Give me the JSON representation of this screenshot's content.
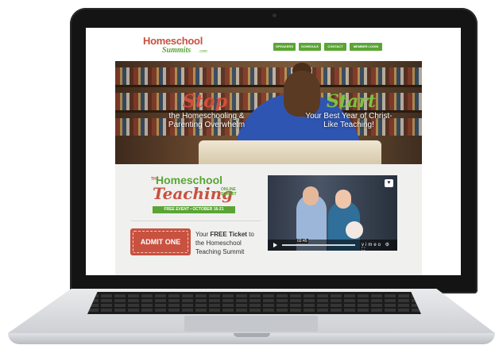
{
  "site": {
    "logo_main": "Homeschool",
    "logo_sub": "Summits",
    "logo_domain": ".com",
    "nav": [
      "SPEAKERS",
      "SCHEDULE",
      "CONTACT",
      "MEMBER LOGIN"
    ]
  },
  "hero": {
    "left_word": "Stop",
    "left_text": "the Homeschooling & Parenting Overwhelm",
    "right_word": "Start",
    "right_text": "Your Best Year of Christ-Like Teaching!"
  },
  "summit": {
    "the": "THE",
    "homeschool": "Homeschool",
    "teaching": "Teaching",
    "online": "ONLINE SUMMIT",
    "free_event": "FREE EVENT • OCTOBER 16-21"
  },
  "ticket": {
    "label": "ADMIT ONE",
    "text_prefix": "Your ",
    "text_bold": "FREE Ticket",
    "text_suffix": " to the Homeschool Teaching Summit"
  },
  "video": {
    "time": "02:45",
    "heart": "♥",
    "controls": "vimeo ⚙ ⛶"
  },
  "colors": {
    "brand_red": "#c8513f",
    "brand_green": "#5aa534",
    "hero_green": "#7cc242"
  }
}
